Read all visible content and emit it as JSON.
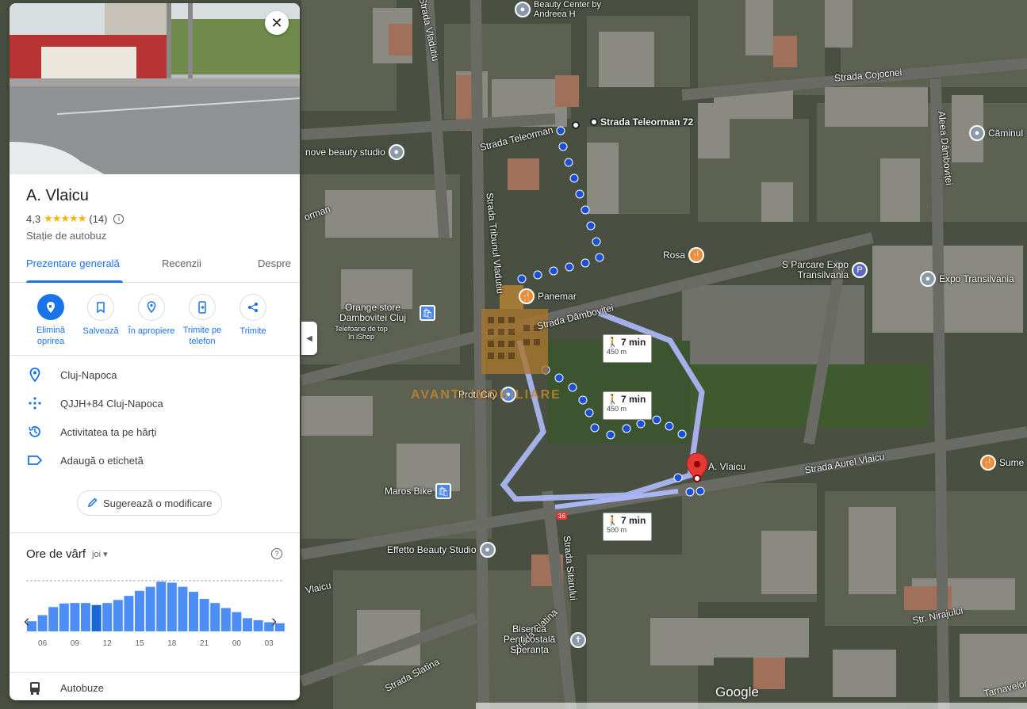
{
  "place": {
    "title": "A. Vlaicu",
    "rating": "4,3",
    "stars": "★★★★★",
    "review_count": "(14)",
    "category": "Stație de autobuz"
  },
  "tabs": [
    {
      "label": "Prezentare generală",
      "active": true
    },
    {
      "label": "Recenzii",
      "active": false
    },
    {
      "label": "Despre",
      "active": false
    }
  ],
  "actions": [
    {
      "label": "Elimină oprirea",
      "icon": "bookmark-pin-icon"
    },
    {
      "label": "Salvează",
      "icon": "bookmark-icon"
    },
    {
      "label": "În apropiere",
      "icon": "nearby-icon"
    },
    {
      "label": "Trimite pe telefon",
      "icon": "phone-icon"
    },
    {
      "label": "Trimite",
      "icon": "share-icon"
    }
  ],
  "info": [
    {
      "text": "Cluj-Napoca",
      "icon": "location-pin-icon"
    },
    {
      "text": "QJJH+84 Cluj-Napoca",
      "icon": "plus-code-icon"
    },
    {
      "text": "Activitatea ta pe hărți",
      "icon": "history-icon"
    },
    {
      "text": "Adaugă o etichetă",
      "icon": "label-icon"
    }
  ],
  "suggest_label": "Sugerează o modificare",
  "peak": {
    "title": "Ore de vârf",
    "day": "joi",
    "ticks": [
      "06",
      "09",
      "12",
      "15",
      "18",
      "21",
      "00",
      "03"
    ],
    "bars": [
      0.2,
      0.32,
      0.48,
      0.55,
      0.56,
      0.56,
      0.52,
      0.56,
      0.62,
      0.7,
      0.8,
      0.88,
      0.98,
      0.96,
      0.88,
      0.78,
      0.64,
      0.56,
      0.46,
      0.38,
      0.26,
      0.22,
      0.18,
      0.16
    ],
    "highlight_index": 6
  },
  "bottom": {
    "label": "Autobuze",
    "icon": "bus-icon"
  },
  "map": {
    "streets": [
      "Strada Teleorman 72",
      "Strada Teleorman",
      "Strada Tribunul Vladutiu",
      "Strada Dâmboviței",
      "Strada Aurel Vlaicu",
      "Strada Cojocnei",
      "Aleea Dâmboviței",
      "Strada Slatina",
      "Strada Slatina",
      "Strada Sitarului",
      "Str. Nirajului",
      "Tarnavelor",
      "Vlaicu",
      "orman",
      "Strada Vladutiu"
    ],
    "pois": [
      "Beauty Center by Andreea H",
      "nove beauty studio",
      "Căminul",
      "Rosa",
      "Panemar",
      "Orange store Dambovitei Cluj",
      "Telefoane de top în iShop",
      "S Parcare Expo Transilvania",
      "Expo Transilvania",
      "Proti City",
      "Maros Bike",
      "Effetto Beauty Studio",
      "Biserica Penticostală Speranța",
      "Sume",
      "A. Vlaicu"
    ],
    "walk": [
      {
        "time": "7 min",
        "dist": "450 m"
      },
      {
        "time": "7 min",
        "dist": "450 m"
      },
      {
        "time": "7 min",
        "dist": "500 m"
      }
    ],
    "watermark": "AVANTI IMOBILIARE",
    "bus_number": "16",
    "logo": "Google"
  }
}
